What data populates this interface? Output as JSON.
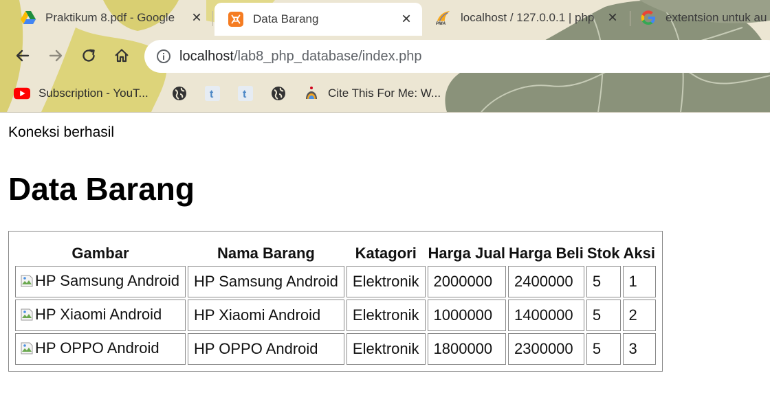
{
  "browser": {
    "tabs": [
      {
        "title": "Praktikum 8.pdf - Google",
        "icon": "google-drive-icon",
        "active": false
      },
      {
        "title": "Data Barang",
        "icon": "xampp-icon",
        "active": true
      },
      {
        "title": "localhost / 127.0.0.1 | php",
        "icon": "phpmyadmin-icon",
        "active": false
      },
      {
        "title": "extentsion untuk au",
        "icon": "google-icon",
        "active": false
      }
    ],
    "url": {
      "host": "localhost",
      "path": "/lab8_php_database/index.php"
    },
    "bookmarks": [
      {
        "label": "Subscription - YouT...",
        "icon": "youtube-icon"
      },
      {
        "label": "",
        "icon": "globe-icon"
      },
      {
        "label": "",
        "icon": "tumblr-icon"
      },
      {
        "label": "",
        "icon": "tumblr-icon"
      },
      {
        "label": "",
        "icon": "globe-icon"
      },
      {
        "label": "Cite This For Me: W...",
        "icon": "cite-this-for-me-icon"
      }
    ],
    "colors": {
      "chrome_bg": "#ece6d3",
      "omnibox_bg": "#ffffff",
      "theme_green": "#8a927a",
      "theme_yellow": "#d9cf72"
    }
  },
  "page": {
    "status": "Koneksi berhasil",
    "heading": "Data Barang",
    "table": {
      "headers": [
        "Gambar",
        "Nama Barang",
        "Katagori",
        "Harga Jual",
        "Harga Beli",
        "Stok",
        "Aksi"
      ],
      "rows": [
        {
          "gambar_alt": "HP Samsung Android",
          "nama": "HP Samsung Android",
          "kategori": "Elektronik",
          "harga_jual": "2000000",
          "harga_beli": "2400000",
          "stok": "5",
          "aksi": "1"
        },
        {
          "gambar_alt": "HP Xiaomi Android",
          "nama": "HP Xiaomi Android",
          "kategori": "Elektronik",
          "harga_jual": "1000000",
          "harga_beli": "1400000",
          "stok": "5",
          "aksi": "2"
        },
        {
          "gambar_alt": "HP OPPO Android",
          "nama": "HP OPPO Android",
          "kategori": "Elektronik",
          "harga_jual": "1800000",
          "harga_beli": "2300000",
          "stok": "5",
          "aksi": "3"
        }
      ]
    }
  }
}
